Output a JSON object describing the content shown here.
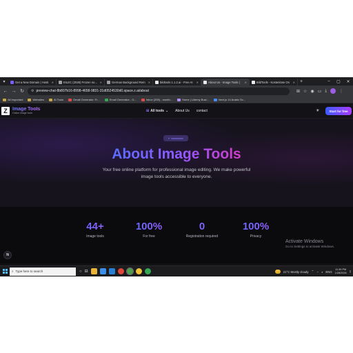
{
  "browser": {
    "tabs": [
      {
        "title": "Get a New Domain | Hosti",
        "color": "#7a5cff"
      },
      {
        "title": "EILEC (2026) Frozen now on",
        "color": "#9aa0a6"
      },
      {
        "title": "German Background Rem",
        "color": "#9aa0a6"
      },
      {
        "title": "bildtools 1.1.2.ai - Free AI",
        "color": "#e8eaed"
      },
      {
        "title": "About Us - Image Tools |",
        "color": "#e8eaed",
        "active": true
      },
      {
        "title": "BildTools - Kostenlose On",
        "color": "#e8eaed"
      }
    ],
    "url": "preview-chat-8b807b16-8998-4658-9831-31d0524530d0.space.z.ai/about",
    "bookmarks": [
      {
        "label": "All Important",
        "icon": "folder-icon"
      },
      {
        "label": "Websites",
        "icon": "folder-icon"
      },
      {
        "label": "AI Tools",
        "icon": "folder-icon"
      },
      {
        "label": "Gmail Generator: Fr...",
        "icon": "gmail-icon"
      },
      {
        "label": "Email Generator - G...",
        "icon": "email-icon"
      },
      {
        "label": "Inbox (205) - month...",
        "icon": "gmail-icon"
      },
      {
        "label": "Home | Udemy Busi...",
        "icon": "udemy-icon"
      },
      {
        "label": "Next.js 14 Arabic Sc...",
        "icon": "page-icon"
      }
    ]
  },
  "site": {
    "logo_letter": "Z",
    "brand_name": "Image Tools",
    "brand_sub": "Online image tools",
    "nav": {
      "all_tools": "All tools",
      "about": "About Us",
      "contact": "contact"
    },
    "cta": "Start for free"
  },
  "hero": {
    "title": "About Image Tools",
    "subtitle": "Your free online platform for professional image editing. We make powerful image tools accessible to everyone."
  },
  "stats": [
    {
      "value": "44+",
      "label": "Image tools"
    },
    {
      "value": "100%",
      "label": "For free"
    },
    {
      "value": "0",
      "label": "Registration required"
    },
    {
      "value": "100%",
      "label": "Privacy"
    }
  ],
  "watermark": {
    "line1": "Activate Windows",
    "line2": "Go to Settings to activate Windows."
  },
  "fab_label": "N",
  "taskbar": {
    "search_placeholder": "Type here to search",
    "weather": "21°C  Mostly cloudy",
    "lang": "ENG",
    "time": "11:39 PM",
    "date": "1/28/2026"
  }
}
